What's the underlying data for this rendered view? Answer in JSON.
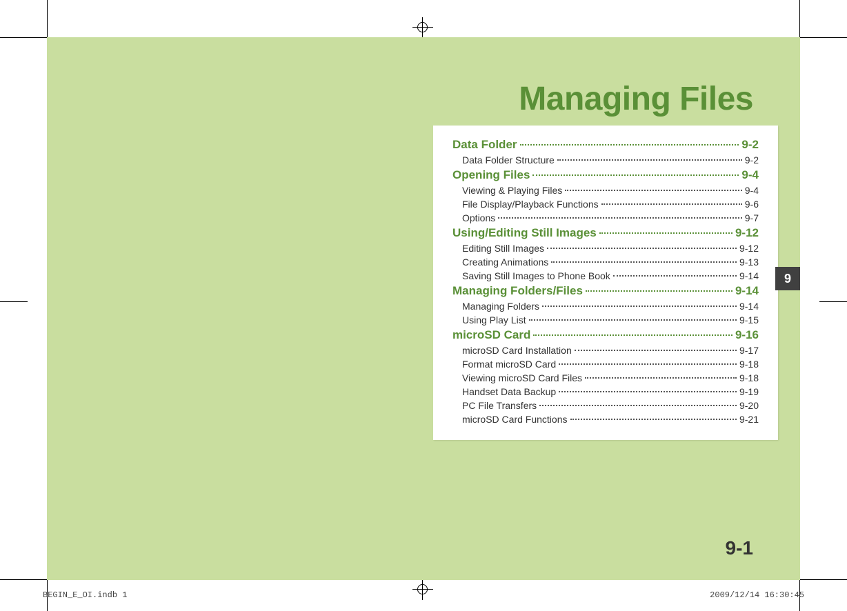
{
  "title": "Managing Files",
  "side_tab": "9",
  "page_number": "9-1",
  "footer_left": "BEGIN_E_OI.indb   1",
  "footer_right": "2009/12/14   16:30:45",
  "toc": {
    "sections": [
      {
        "label": "Data Folder",
        "page": "9-2",
        "subs": [
          {
            "label": "Data Folder Structure",
            "page": "9-2"
          }
        ]
      },
      {
        "label": "Opening Files",
        "page": "9-4",
        "subs": [
          {
            "label": "Viewing & Playing Files",
            "page": "9-4"
          },
          {
            "label": "File Display/Playback Functions",
            "page": "9-6"
          },
          {
            "label": "Options",
            "page": "9-7"
          }
        ]
      },
      {
        "label": "Using/Editing Still Images",
        "page": "9-12",
        "subs": [
          {
            "label": "Editing Still Images",
            "page": "9-12"
          },
          {
            "label": "Creating Animations",
            "page": "9-13"
          },
          {
            "label": "Saving Still Images to Phone Book",
            "page": "9-14"
          }
        ]
      },
      {
        "label": "Managing Folders/Files",
        "page": "9-14",
        "subs": [
          {
            "label": "Managing Folders",
            "page": "9-14"
          },
          {
            "label": "Using Play List",
            "page": "9-15"
          }
        ]
      },
      {
        "label": "microSD Card",
        "page": "9-16",
        "subs": [
          {
            "label": "microSD Card Installation",
            "page": "9-17"
          },
          {
            "label": "Format microSD Card",
            "page": "9-18"
          },
          {
            "label": "Viewing microSD Card Files",
            "page": "9-18"
          },
          {
            "label": "Handset Data Backup",
            "page": "9-19"
          },
          {
            "label": "PC File Transfers",
            "page": "9-20"
          },
          {
            "label": "microSD Card Functions",
            "page": "9-21"
          }
        ]
      }
    ]
  }
}
